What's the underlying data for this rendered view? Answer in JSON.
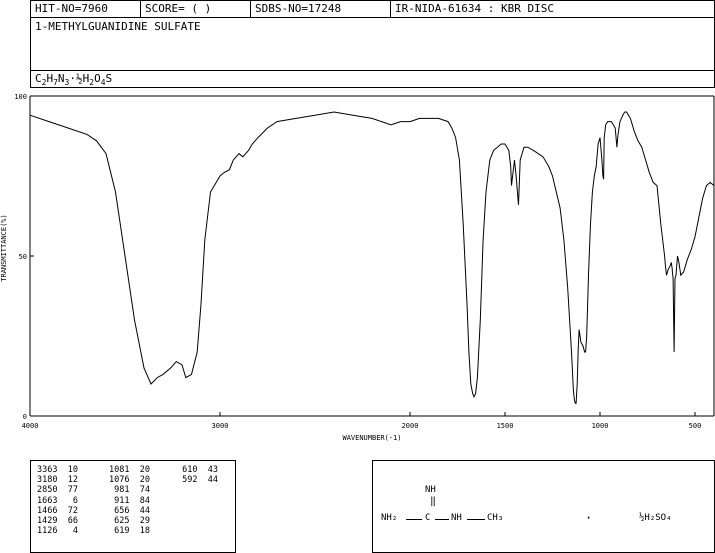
{
  "header": {
    "hit_no": "HIT-NO=7960",
    "score": "SCORE=  (   )",
    "sdbs_no": "SDBS-NO=17248",
    "ir_nida": "IR-NIDA-61634 : KBR DISC"
  },
  "compound": {
    "name": "1-METHYLGUANIDINE SULFATE"
  },
  "chart_data": {
    "type": "line",
    "xlabel": "WAVENUMBER(-1)",
    "ylabel": "TRANSMITTANCE(%)",
    "xlim": [
      4000,
      400
    ],
    "ylim": [
      0,
      100
    ],
    "x_ticks": [
      4000,
      3000,
      2000,
      1500,
      1000,
      500
    ],
    "y_ticks": [
      0,
      50,
      100
    ],
    "grid": false,
    "series": [
      {
        "x": [
          4000,
          3900,
          3800,
          3700,
          3650,
          3600,
          3550,
          3500,
          3450,
          3400,
          3363,
          3330,
          3300,
          3260,
          3230,
          3200,
          3180,
          3150,
          3120,
          3100,
          3080,
          3050,
          3000,
          2980,
          2950,
          2930,
          2900,
          2880,
          2850,
          2830,
          2800,
          2750,
          2700,
          2600,
          2500,
          2400,
          2300,
          2200,
          2100,
          2050,
          2000,
          1950,
          1900,
          1850,
          1800,
          1780,
          1760,
          1740,
          1720,
          1700,
          1690,
          1680,
          1670,
          1663,
          1655,
          1645,
          1630,
          1615,
          1600,
          1580,
          1560,
          1540,
          1520,
          1500,
          1480,
          1470,
          1466,
          1460,
          1450,
          1440,
          1435,
          1429,
          1420,
          1400,
          1380,
          1350,
          1300,
          1270,
          1250,
          1230,
          1210,
          1190,
          1170,
          1150,
          1140,
          1135,
          1130,
          1126,
          1120,
          1115,
          1110,
          1100,
          1090,
          1081,
          1076,
          1070,
          1060,
          1050,
          1040,
          1030,
          1020,
          1010,
          1000,
          990,
          985,
          981,
          978,
          970,
          960,
          950,
          940,
          930,
          920,
          911,
          905,
          895,
          880,
          870,
          860,
          850,
          840,
          830,
          820,
          800,
          780,
          760,
          740,
          720,
          700,
          690,
          680,
          670,
          660,
          656,
          650,
          640,
          630,
          625,
          620,
          619,
          615,
          610,
          605,
          600,
          592,
          585,
          575,
          560,
          540,
          520,
          500,
          480,
          460,
          440,
          420,
          400
        ],
        "y": [
          94,
          92,
          90,
          88,
          86,
          82,
          70,
          50,
          30,
          15,
          10,
          12,
          13,
          15,
          17,
          16,
          12,
          13,
          20,
          35,
          55,
          70,
          75,
          76,
          77,
          80,
          82,
          81,
          83,
          85,
          87,
          90,
          92,
          93,
          94,
          95,
          94,
          93,
          91,
          92,
          92,
          93,
          93,
          93,
          92,
          90,
          87,
          80,
          60,
          35,
          20,
          10,
          7,
          6,
          7,
          12,
          30,
          55,
          70,
          80,
          83,
          84,
          85,
          85,
          83,
          78,
          72,
          75,
          80,
          74,
          70,
          66,
          80,
          84,
          84,
          83,
          81,
          78,
          75,
          70,
          65,
          55,
          40,
          20,
          8,
          5,
          4,
          4,
          10,
          20,
          27,
          23,
          22,
          20,
          20,
          25,
          45,
          60,
          70,
          75,
          78,
          85,
          87,
          80,
          75,
          74,
          87,
          91,
          92,
          92,
          92,
          91,
          90,
          84,
          88,
          92,
          94,
          95,
          95,
          94,
          93,
          91,
          89,
          86,
          84,
          80,
          76,
          73,
          72,
          66,
          60,
          55,
          50,
          47,
          44,
          46,
          47,
          48,
          46,
          45,
          43,
          20,
          43,
          44,
          50,
          48,
          44,
          45,
          49,
          52,
          56,
          62,
          68,
          72,
          73,
          72
        ]
      }
    ]
  },
  "peaks": {
    "col1": [
      "3363  10",
      "3180  12",
      "2850  77",
      "1663   6",
      "1466  72",
      "1429  66",
      "1126   4"
    ],
    "col2": [
      "1081  20",
      "1076  20",
      " 981  74",
      " 911  84",
      " 656  44",
      " 625  29",
      " 619  18"
    ],
    "col3": [
      " 610  43",
      " 592  44"
    ]
  },
  "structure": {
    "imine": "NH",
    "left_amine": "NH₂",
    "carbon": "C",
    "right_amine": "NH",
    "methyl": "CH₃",
    "dot": "·",
    "salt": "½H₂SO₄"
  }
}
